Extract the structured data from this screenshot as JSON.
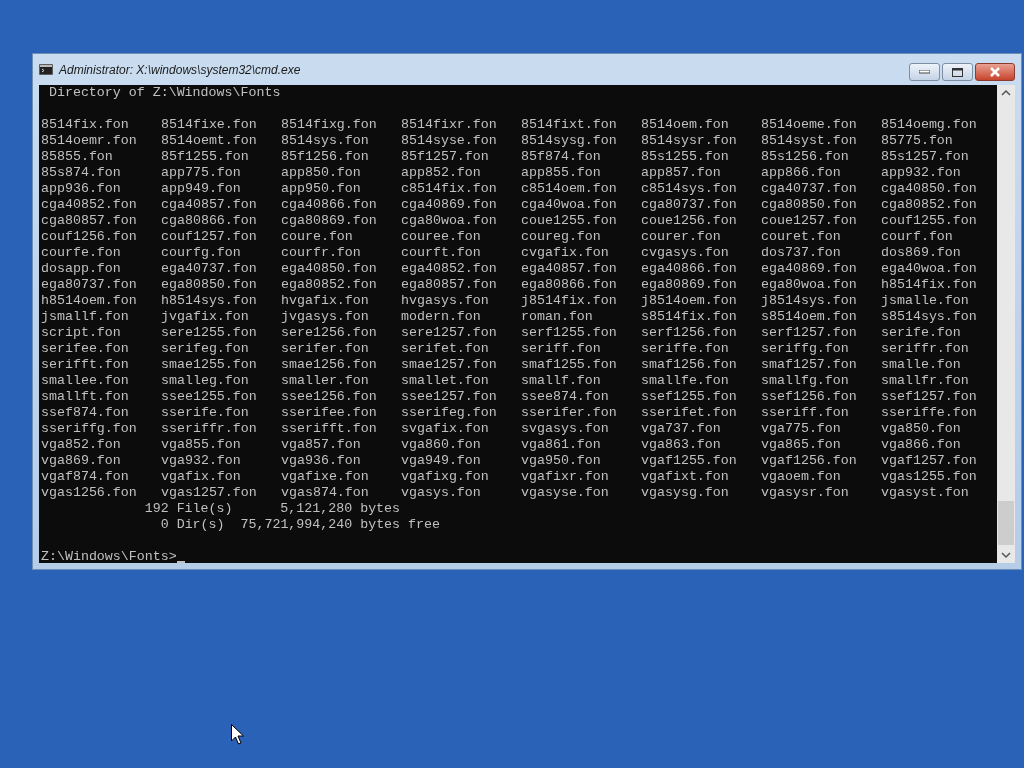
{
  "window": {
    "title": "Administrator: X:\\windows\\system32\\cmd.exe"
  },
  "console": {
    "header": "Directory of Z:\\Windows\\Fonts",
    "files": [
      [
        "8514fix.fon",
        "8514fixe.fon",
        "8514fixg.fon",
        "8514fixr.fon",
        "8514fixt.fon",
        "8514oem.fon",
        "8514oeme.fon",
        "8514oemg.fon"
      ],
      [
        "8514oemr.fon",
        "8514oemt.fon",
        "8514sys.fon",
        "8514syse.fon",
        "8514sysg.fon",
        "8514sysr.fon",
        "8514syst.fon",
        "85775.fon"
      ],
      [
        "85855.fon",
        "85f1255.fon",
        "85f1256.fon",
        "85f1257.fon",
        "85f874.fon",
        "85s1255.fon",
        "85s1256.fon",
        "85s1257.fon"
      ],
      [
        "85s874.fon",
        "app775.fon",
        "app850.fon",
        "app852.fon",
        "app855.fon",
        "app857.fon",
        "app866.fon",
        "app932.fon"
      ],
      [
        "app936.fon",
        "app949.fon",
        "app950.fon",
        "c8514fix.fon",
        "c8514oem.fon",
        "c8514sys.fon",
        "cga40737.fon",
        "cga40850.fon"
      ],
      [
        "cga40852.fon",
        "cga40857.fon",
        "cga40866.fon",
        "cga40869.fon",
        "cga40woa.fon",
        "cga80737.fon",
        "cga80850.fon",
        "cga80852.fon"
      ],
      [
        "cga80857.fon",
        "cga80866.fon",
        "cga80869.fon",
        "cga80woa.fon",
        "coue1255.fon",
        "coue1256.fon",
        "coue1257.fon",
        "couf1255.fon"
      ],
      [
        "couf1256.fon",
        "couf1257.fon",
        "coure.fon",
        "couree.fon",
        "coureg.fon",
        "courer.fon",
        "couret.fon",
        "courf.fon"
      ],
      [
        "courfe.fon",
        "courfg.fon",
        "courfr.fon",
        "courft.fon",
        "cvgafix.fon",
        "cvgasys.fon",
        "dos737.fon",
        "dos869.fon"
      ],
      [
        "dosapp.fon",
        "ega40737.fon",
        "ega40850.fon",
        "ega40852.fon",
        "ega40857.fon",
        "ega40866.fon",
        "ega40869.fon",
        "ega40woa.fon"
      ],
      [
        "ega80737.fon",
        "ega80850.fon",
        "ega80852.fon",
        "ega80857.fon",
        "ega80866.fon",
        "ega80869.fon",
        "ega80woa.fon",
        "h8514fix.fon"
      ],
      [
        "h8514oem.fon",
        "h8514sys.fon",
        "hvgafix.fon",
        "hvgasys.fon",
        "j8514fix.fon",
        "j8514oem.fon",
        "j8514sys.fon",
        "jsmalle.fon"
      ],
      [
        "jsmallf.fon",
        "jvgafix.fon",
        "jvgasys.fon",
        "modern.fon",
        "roman.fon",
        "s8514fix.fon",
        "s8514oem.fon",
        "s8514sys.fon"
      ],
      [
        "script.fon",
        "sere1255.fon",
        "sere1256.fon",
        "sere1257.fon",
        "serf1255.fon",
        "serf1256.fon",
        "serf1257.fon",
        "serife.fon"
      ],
      [
        "serifee.fon",
        "serifeg.fon",
        "serifer.fon",
        "serifet.fon",
        "seriff.fon",
        "seriffe.fon",
        "seriffg.fon",
        "seriffr.fon"
      ],
      [
        "serifft.fon",
        "smae1255.fon",
        "smae1256.fon",
        "smae1257.fon",
        "smaf1255.fon",
        "smaf1256.fon",
        "smaf1257.fon",
        "smalle.fon"
      ],
      [
        "smallee.fon",
        "smalleg.fon",
        "smaller.fon",
        "smallet.fon",
        "smallf.fon",
        "smallfe.fon",
        "smallfg.fon",
        "smallfr.fon"
      ],
      [
        "smallft.fon",
        "ssee1255.fon",
        "ssee1256.fon",
        "ssee1257.fon",
        "ssee874.fon",
        "ssef1255.fon",
        "ssef1256.fon",
        "ssef1257.fon"
      ],
      [
        "ssef874.fon",
        "sserife.fon",
        "sserifee.fon",
        "sserifeg.fon",
        "sserifer.fon",
        "sserifet.fon",
        "sseriff.fon",
        "sseriffe.fon"
      ],
      [
        "sseriffg.fon",
        "sseriffr.fon",
        "sserifft.fon",
        "svgafix.fon",
        "svgasys.fon",
        "vga737.fon",
        "vga775.fon",
        "vga850.fon"
      ],
      [
        "vga852.fon",
        "vga855.fon",
        "vga857.fon",
        "vga860.fon",
        "vga861.fon",
        "vga863.fon",
        "vga865.fon",
        "vga866.fon"
      ],
      [
        "vga869.fon",
        "vga932.fon",
        "vga936.fon",
        "vga949.fon",
        "vga950.fon",
        "vgaf1255.fon",
        "vgaf1256.fon",
        "vgaf1257.fon"
      ],
      [
        "vgaf874.fon",
        "vgafix.fon",
        "vgafixe.fon",
        "vgafixg.fon",
        "vgafixr.fon",
        "vgafixt.fon",
        "vgaoem.fon",
        "vgas1255.fon"
      ],
      [
        "vgas1256.fon",
        "vgas1257.fon",
        "vgas874.fon",
        "vgasys.fon",
        "vgasyse.fon",
        "vgasysg.fon",
        "vgasysr.fon",
        "vgasyst.fon"
      ]
    ],
    "summary": [
      "192 File(s)      5,121,280 bytes",
      "0 Dir(s)  75,721,994,240 bytes free"
    ],
    "prompt": "Z:\\Windows\\Fonts>"
  }
}
